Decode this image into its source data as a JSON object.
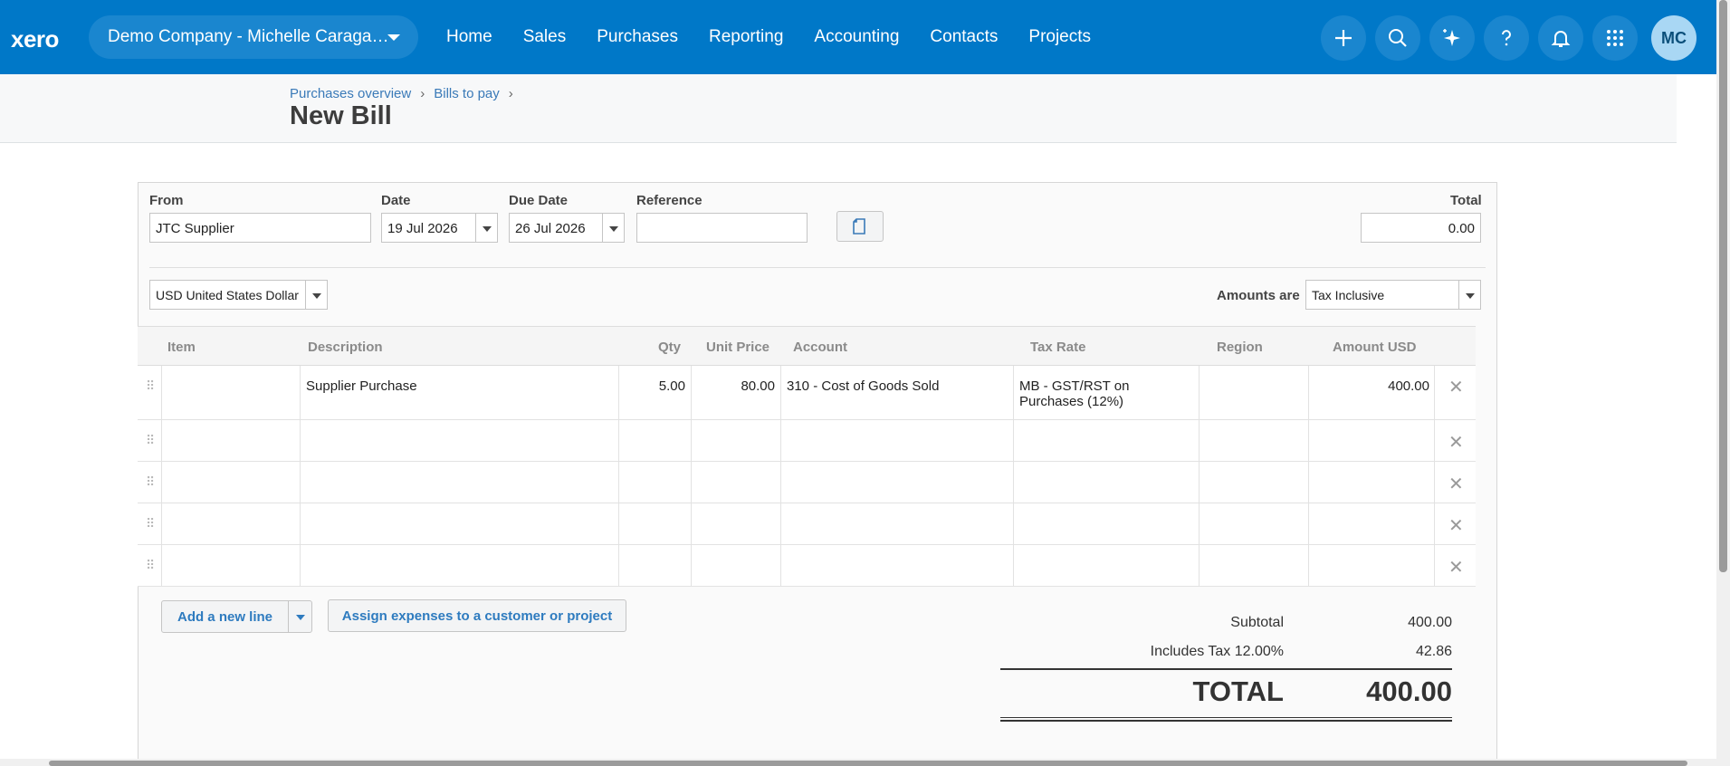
{
  "topbar": {
    "logo": "xero",
    "org_name": "Demo Company - Michelle Caraga…",
    "nav": [
      "Home",
      "Sales",
      "Purchases",
      "Reporting",
      "Accounting",
      "Contacts",
      "Projects"
    ],
    "avatar_initials": "MC",
    "icons": [
      "plus-icon",
      "search-icon",
      "sparkle-icon",
      "help-icon",
      "bell-icon",
      "apps-grid-icon"
    ]
  },
  "breadcrumb": {
    "items": [
      "Purchases overview",
      "Bills to pay"
    ],
    "separator": "›"
  },
  "page_title": "New Bill",
  "form": {
    "from_label": "From",
    "from_value": "JTC Supplier",
    "date_label": "Date",
    "date_value": "19 Jul 2026",
    "due_label": "Due Date",
    "due_value": "26 Jul 2026",
    "reference_label": "Reference",
    "reference_value": "",
    "total_label": "Total",
    "total_value": "0.00",
    "currency": "USD United States Dollar",
    "amounts_are_label": "Amounts are",
    "amounts_are_value": "Tax Inclusive"
  },
  "table": {
    "headers": [
      "Item",
      "Description",
      "Qty",
      "Unit Price",
      "Account",
      "Tax Rate",
      "Region",
      "Amount USD"
    ],
    "rows": [
      {
        "item": "",
        "description": "Supplier Purchase",
        "qty": "5.00",
        "unit_price": "80.00",
        "account": "310 - Cost of Goods Sold",
        "tax_rate_1": "MB - GST/RST on",
        "tax_rate_2": "Purchases (12%)",
        "region": "",
        "amount": "400.00"
      },
      {
        "item": "",
        "description": "",
        "qty": "",
        "unit_price": "",
        "account": "",
        "tax_rate_1": "",
        "tax_rate_2": "",
        "region": "",
        "amount": ""
      },
      {
        "item": "",
        "description": "",
        "qty": "",
        "unit_price": "",
        "account": "",
        "tax_rate_1": "",
        "tax_rate_2": "",
        "region": "",
        "amount": ""
      },
      {
        "item": "",
        "description": "",
        "qty": "",
        "unit_price": "",
        "account": "",
        "tax_rate_1": "",
        "tax_rate_2": "",
        "region": "",
        "amount": ""
      },
      {
        "item": "",
        "description": "",
        "qty": "",
        "unit_price": "",
        "account": "",
        "tax_rate_1": "",
        "tax_rate_2": "",
        "region": "",
        "amount": ""
      }
    ],
    "delete_glyph": "✕",
    "handle_glyph": "⠿"
  },
  "actions": {
    "add_line": "Add a new line",
    "assign": "Assign expenses to a customer or project"
  },
  "totals": {
    "subtotal_label": "Subtotal",
    "subtotal_value": "400.00",
    "tax_label": "Includes Tax 12.00%",
    "tax_value": "42.86",
    "total_label": "TOTAL",
    "total_value": "400.00"
  },
  "colors": {
    "brand": "#0078c8",
    "link": "#3a7ab8"
  }
}
